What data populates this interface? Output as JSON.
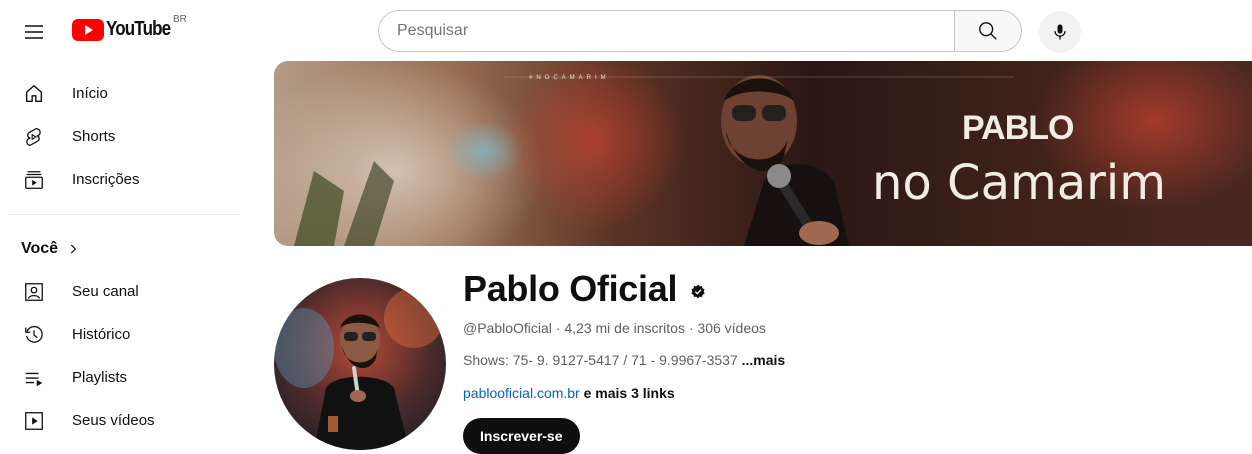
{
  "header": {
    "logo_text": "YouTube",
    "country_code": "BR",
    "search_placeholder": "Pesquisar"
  },
  "sidebar": {
    "main_items": [
      {
        "label": "Início",
        "icon": "home-icon"
      },
      {
        "label": "Shorts",
        "icon": "shorts-icon"
      },
      {
        "label": "Inscrições",
        "icon": "subscriptions-icon"
      }
    ],
    "you_section_label": "Você",
    "you_items": [
      {
        "label": "Seu canal",
        "icon": "your-channel-icon"
      },
      {
        "label": "Histórico",
        "icon": "history-icon"
      },
      {
        "label": "Playlists",
        "icon": "playlists-icon"
      },
      {
        "label": "Seus vídeos",
        "icon": "your-videos-icon"
      }
    ]
  },
  "banner": {
    "small_tag": "#NOCAMARIM",
    "title_line1": "PABLO",
    "title_line2": "no Camarim"
  },
  "channel": {
    "name": "Pablo Oficial",
    "handle_stats": "@PabloOficial · 4,23 mi de inscritos · 306 vídeos",
    "description": "Shows: 75- 9. 9127-5417  /  71 - 9.9967-3537 ",
    "description_more": "...mais",
    "link_main": "pablooficial.com.br",
    "link_more": " e mais 3 links",
    "subscribe_label": "Inscrever-se"
  },
  "colors": {
    "brand_red": "#ff0000",
    "link_blue": "#065fd4",
    "text_primary": "#0f0f0f",
    "text_secondary": "#606060"
  }
}
